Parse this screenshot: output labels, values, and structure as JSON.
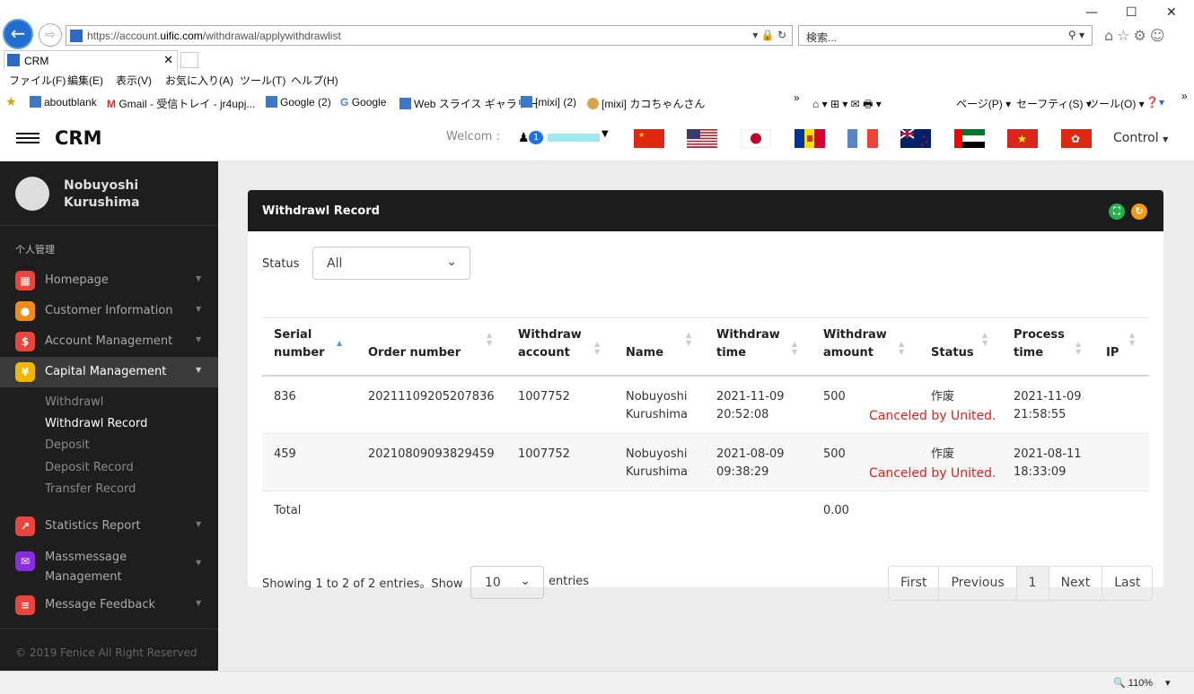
{
  "browser": {
    "url_host": "https://account.",
    "url_domain": "uific.com",
    "url_path": "/withdrawal/applywithdrawlist",
    "search_placeholder": "検索...",
    "tab_title": "CRM",
    "menu": [
      "ファイル(F)",
      "編集(E)",
      "表示(V)",
      "お気に入り(A)",
      "ツール(T)",
      "ヘルプ(H)"
    ],
    "favorites": [
      "aboutblank",
      "Gmail - 受信トレイ - jr4upj...",
      "Google (2)",
      "Google",
      "Web スライス ギャラリー",
      "[mixi] (2)",
      "[mixi] カコちゃんさん"
    ],
    "cmd_page": "ページ(P)",
    "cmd_safety": "セーフティ(S)",
    "cmd_tools": "ツール(O)",
    "zoom": "110%"
  },
  "header": {
    "title": "CRM",
    "welcome": "Welcom :",
    "badge": "1",
    "control": "Control"
  },
  "sidebar": {
    "user_name_1": "Nobuyoshi",
    "user_name_2": "Kurushima",
    "section": "个人管理",
    "items": [
      {
        "label": "Homepage",
        "color": "#e8453c"
      },
      {
        "label": "Customer Information",
        "color": "#f08c1a"
      },
      {
        "label": "Account Management",
        "color": "#e8453c"
      },
      {
        "label": "Capital Management",
        "color": "#f2b600"
      },
      {
        "label": "Statistics Report",
        "color": "#e8453c"
      },
      {
        "label": "Massmessage",
        "label2": "Management",
        "color": "#8a2be2"
      },
      {
        "label": "Message Feedback",
        "color": "#e8453c"
      }
    ],
    "sub_items": [
      "Withdrawl",
      "Withdrawl Record",
      "Deposit",
      "Deposit Record",
      "Transfer Record"
    ],
    "copyright": "© 2019 Fenice All Right Reserved"
  },
  "card": {
    "title": "Withdrawl Record",
    "status_label": "Status",
    "status_value": "All",
    "columns": [
      [
        "Serial",
        "number"
      ],
      [
        "",
        "Order number"
      ],
      [
        "Withdraw",
        "account"
      ],
      [
        "",
        "Name"
      ],
      [
        "Withdraw",
        "time"
      ],
      [
        "Withdraw",
        "amount"
      ],
      [
        "",
        "Status"
      ],
      [
        "Process",
        "time"
      ],
      [
        "",
        "IP"
      ]
    ],
    "rows": [
      {
        "serial": "836",
        "order": "20211109205207836",
        "account": "1007752",
        "name1": "Nobuyoshi",
        "name2": "Kurushima",
        "time1": "2021-11-09",
        "time2": "20:52:08",
        "amount": "500",
        "status": "作废",
        "note": "Canceled by United.",
        "ptime1": "2021-11-09",
        "ptime2": "21:58:55"
      },
      {
        "serial": "459",
        "order": "20210809093829459",
        "account": "1007752",
        "name1": "Nobuyoshi",
        "name2": "Kurushima",
        "time1": "2021-08-09",
        "time2": "09:38:29",
        "amount": "500",
        "status": "作废",
        "note": "Canceled by United.",
        "ptime1": "2021-08-11",
        "ptime2": "18:33:09"
      }
    ],
    "total_label": "Total",
    "total_value": "0.00",
    "info": "Showing 1 to 2 of 2 entries。Show",
    "length_value": "10",
    "entries_label": "entries",
    "pager": [
      "First",
      "Previous",
      "1",
      "Next",
      "Last"
    ]
  }
}
